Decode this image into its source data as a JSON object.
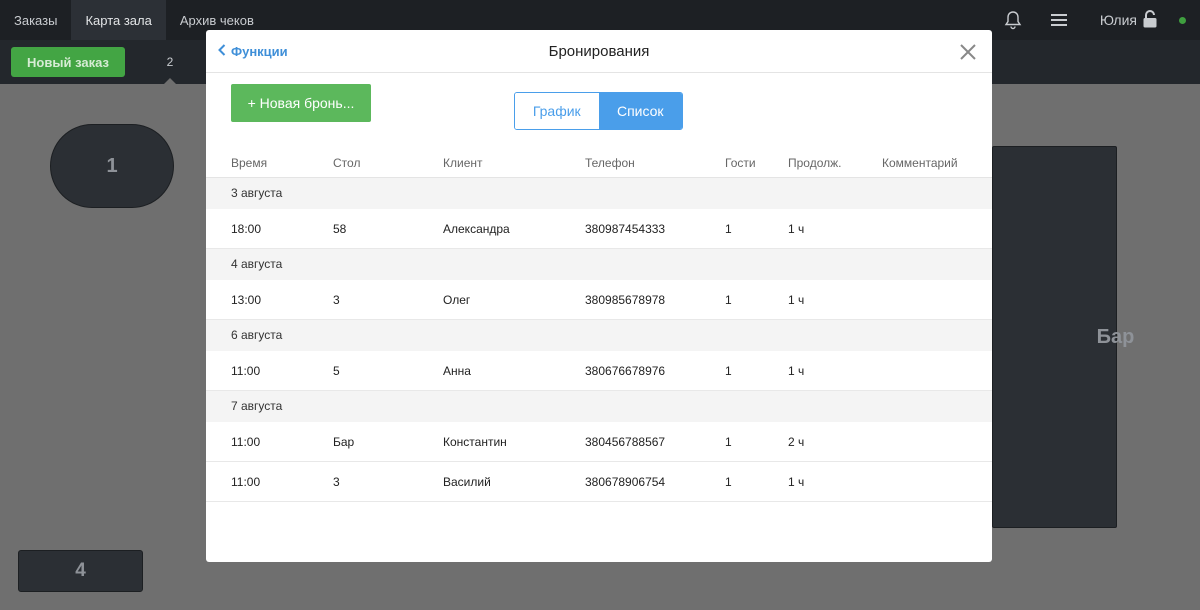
{
  "topnav": {
    "tabs": [
      "Заказы",
      "Карта зала",
      "Архив чеков"
    ],
    "user_name": "Юлия"
  },
  "subbar": {
    "new_order_label": "Новый заказ",
    "hall_tab_label": "2"
  },
  "floor": {
    "table_1": "1",
    "table_bar": "Бар",
    "table_4": "4"
  },
  "modal": {
    "back_label": "Функции",
    "title": "Бронирования",
    "new_booking_label": "+ Новая бронь...",
    "view_toggle": {
      "schedule": "График",
      "list": "Список",
      "active": "Список"
    },
    "columns": [
      "Время",
      "Стол",
      "Клиент",
      "Телефон",
      "Гости",
      "Продолж.",
      "Комментарий"
    ],
    "groups": [
      {
        "date": "3 августа",
        "rows": [
          {
            "time": "18:00",
            "table": "58",
            "client": "Александра",
            "phone": "380987454333",
            "guests": "1",
            "duration": "1 ч",
            "comment": ""
          }
        ]
      },
      {
        "date": "4 августа",
        "rows": [
          {
            "time": "13:00",
            "table": "3",
            "client": "Олег",
            "phone": "380985678978",
            "guests": "1",
            "duration": "1 ч",
            "comment": ""
          }
        ]
      },
      {
        "date": "6 августа",
        "rows": [
          {
            "time": "11:00",
            "table": "5",
            "client": "Анна",
            "phone": "380676678976",
            "guests": "1",
            "duration": "1 ч",
            "comment": ""
          }
        ]
      },
      {
        "date": "7 августа",
        "rows": [
          {
            "time": "11:00",
            "table": "Бар",
            "client": "Константин",
            "phone": "380456788567",
            "guests": "1",
            "duration": "2 ч",
            "comment": ""
          },
          {
            "time": "11:00",
            "table": "3",
            "client": "Василий",
            "phone": "380678906754",
            "guests": "1",
            "duration": "1 ч",
            "comment": ""
          }
        ]
      }
    ]
  },
  "colors": {
    "accent_blue": "#4a9eea",
    "green": "#5cb85c",
    "nav_bg": "#1d2024"
  }
}
